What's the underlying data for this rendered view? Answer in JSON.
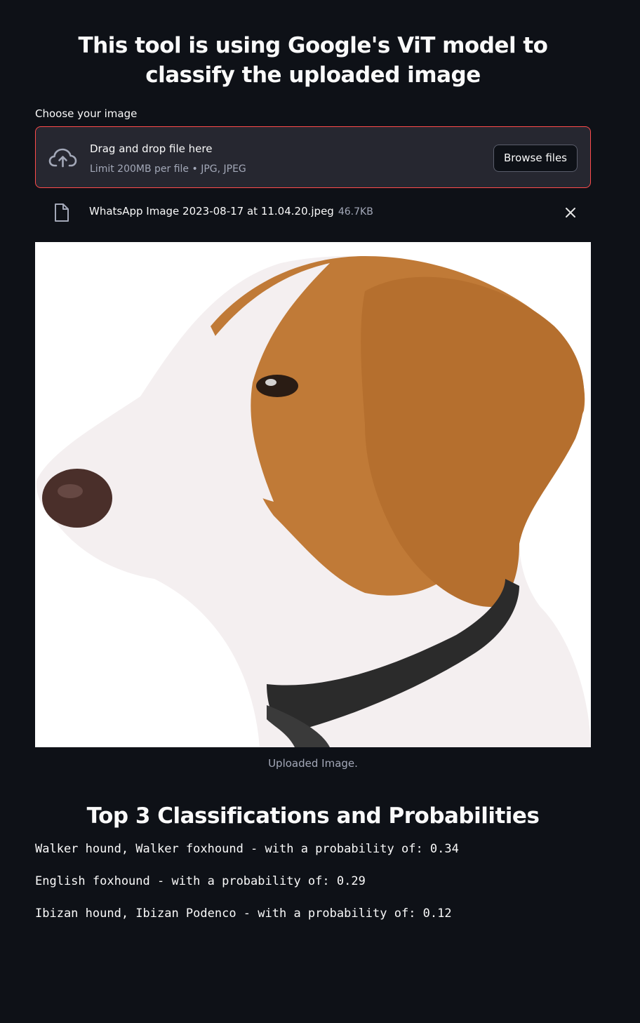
{
  "header": {
    "title": "This tool is using Google's ViT model to classify the uploaded image"
  },
  "uploader": {
    "label": "Choose your image",
    "drop_title": "Drag and drop file here",
    "drop_limits": "Limit 200MB per file • JPG, JPEG",
    "browse_label": "Browse files",
    "file_name": "WhatsApp Image 2023-08-17 at 11.04.20.jpeg",
    "file_size": "46.7KB"
  },
  "image": {
    "caption": "Uploaded Image."
  },
  "results": {
    "title": "Top 3 Classifications and Probabilities",
    "items": [
      "Walker hound, Walker foxhound - with a probability of: 0.34",
      "English foxhound - with a probability of: 0.29",
      "Ibizan hound, Ibizan Podenco - with a probability of: 0.12"
    ]
  },
  "colors": {
    "background": "#0e1117",
    "accent": "#ff4b4b",
    "dropzone": "#262730",
    "muted_text": "#a3a8b8"
  },
  "icons": [
    "cloud-upload-icon",
    "file-icon",
    "close-icon"
  ]
}
